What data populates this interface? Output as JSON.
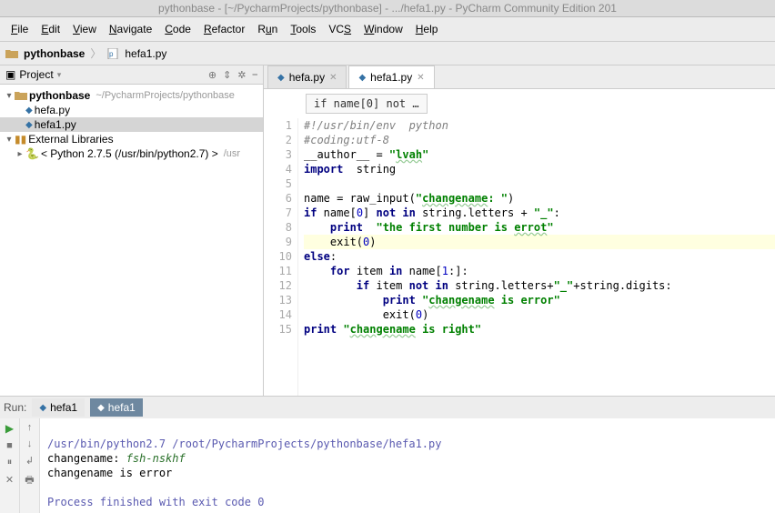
{
  "titlebar": "pythonbase - [~/PycharmProjects/pythonbase] - .../hefa1.py - PyCharm Community Edition 201",
  "menus": [
    "File",
    "Edit",
    "View",
    "Navigate",
    "Code",
    "Refactor",
    "Run",
    "Tools",
    "VCS",
    "Window",
    "Help"
  ],
  "breadcrumb": {
    "project": "pythonbase",
    "file": "hefa1.py"
  },
  "sidebar": {
    "title": "Project",
    "tree": {
      "root": {
        "name": "pythonbase",
        "hint": "~/PycharmProjects/pythonbase"
      },
      "files": [
        "hefa.py",
        "hefa1.py"
      ],
      "ext": "External Libraries",
      "python_env": "< Python 2.7.5 (/usr/bin/python2.7) >",
      "python_env_hint": "/usr"
    }
  },
  "editor": {
    "tabs": [
      {
        "label": "hefa.py",
        "active": false
      },
      {
        "label": "hefa1.py",
        "active": true
      }
    ],
    "crumb": "if name[0] not …",
    "lines": [
      {
        "n": 1,
        "html": "<span class='comment'>#!/usr/bin/env  python</span>"
      },
      {
        "n": 2,
        "html": "<span class='comment'>#coding:utf-8</span>"
      },
      {
        "n": 3,
        "html": "__author__ = <span class='str'>\"<span class='underl'>lvah</span>\"</span>"
      },
      {
        "n": 4,
        "html": "<span class='kw'>import</span>  string"
      },
      {
        "n": 5,
        "html": ""
      },
      {
        "n": 6,
        "html": "name = raw_input(<span class='str'>\"<span class='underl'>changename</span>: \"</span>)"
      },
      {
        "n": 7,
        "html": "<span class='kw'>if</span> name[<span class='num'>0</span>] <span class='kw'>not in</span> string.letters + <span class='str'>\"_\"</span>:"
      },
      {
        "n": 8,
        "html": "    <span class='kw'>print</span>  <span class='str'>\"the first number is <span class='underl'>errot</span>\"</span>"
      },
      {
        "n": 9,
        "html": "    exit(<span class='num'>0</span>)",
        "hl": true
      },
      {
        "n": 10,
        "html": "<span class='kw'>else</span>:"
      },
      {
        "n": 11,
        "html": "    <span class='kw'>for</span> item <span class='kw'>in</span> name[<span class='num'>1</span>:]:"
      },
      {
        "n": 12,
        "html": "        <span class='kw'>if</span> item <span class='kw'>not in</span> string.letters+<span class='str'>\"_\"</span>+string.digits:"
      },
      {
        "n": 13,
        "html": "            <span class='kw'>print</span> <span class='str'>\"<span class='underl'>changename</span> is error\"</span>"
      },
      {
        "n": 14,
        "html": "            exit(<span class='num'>0</span>)"
      },
      {
        "n": 15,
        "html": "<span class='kw'>print</span> <span class='str'>\"<span class='underl'>changename</span> is right\"</span>"
      }
    ]
  },
  "run": {
    "label": "Run:",
    "tabs": [
      {
        "label": "hefa1",
        "active": false
      },
      {
        "label": "hefa1",
        "active": true
      }
    ],
    "console": {
      "cmd": "/usr/bin/python2.7 /root/PycharmProjects/pythonbase/hefa1.py",
      "prompt": "changename: ",
      "input": "fsh-nskhf",
      "out": "changename is error",
      "exit": "Process finished with exit code 0"
    }
  }
}
